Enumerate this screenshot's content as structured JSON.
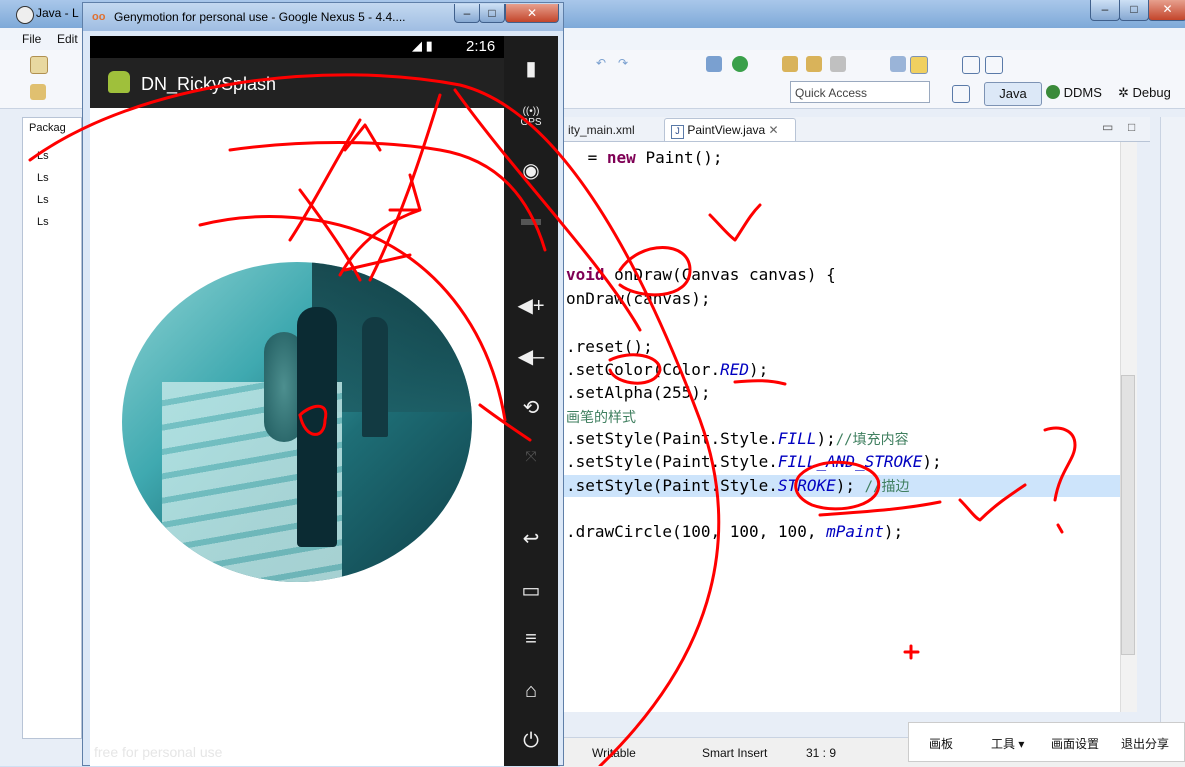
{
  "eclipse": {
    "title": "Java - L",
    "menu": [
      "File",
      "Edit"
    ],
    "quick_access": "Quick Access",
    "perspectives": [
      "Java",
      "DDMS",
      "Debug"
    ],
    "package_explorer_tab": "Packag",
    "package_rows": [
      "Ls",
      "Ls",
      "Ls",
      "Ls"
    ],
    "editor_tabs": [
      "ity_main.xml",
      "PaintView.java"
    ],
    "code_lines": [
      {
        "pre": " = ",
        "kw": "new",
        "post": " Paint();"
      },
      {
        "pre": "",
        "kw": "void",
        "post": " onDraw(Canvas canvas) {"
      },
      {
        "pre": "onDraw(canvas);",
        "kw": "",
        "post": ""
      },
      {
        "pre": ".reset();",
        "kw": "",
        "post": ""
      },
      {
        "pre": ".setColor(Color.",
        "field": "RED",
        "post": ");"
      },
      {
        "pre": ".setAlpha(255);",
        "kw": "",
        "post": ""
      },
      {
        "comment": "画笔的样式"
      },
      {
        "pre": ".setStyle(Paint.Style.",
        "field": "FILL",
        "post": ");",
        "comment": "//填充内容"
      },
      {
        "pre": ".setStyle(Paint.Style.",
        "field": "FILL_AND_STROKE",
        "post": ");"
      },
      {
        "pre": ".setStyle(Paint.Style.",
        "field": "STROKE",
        "post": ");",
        "comment": "//描边"
      },
      {
        "pre": ".drawCircle(100, 100, 100, ",
        "field2": "mPaint",
        "post": ");"
      }
    ],
    "status": {
      "writable": "Writable",
      "insert": "Smart Insert",
      "position": "31 : 9"
    },
    "overlay_tools": [
      "画板",
      "工具 ▾",
      "画面设置",
      "退出分享"
    ]
  },
  "genymotion": {
    "title": "Genymotion for personal use - Google Nexus 5 - 4.4....",
    "status_time": "2:16",
    "app_title": "DN_RickySplash",
    "watermark": "free for personal use",
    "sidebar": [
      "battery-icon",
      "gps-icon",
      "webcam-icon",
      "media-icon",
      "volume-up-icon",
      "volume-down-icon",
      "rotate-icon",
      "pixel-perfect-icon",
      "back-icon",
      "recent-apps-icon",
      "menu-icon",
      "home-icon",
      "power-icon"
    ],
    "gps_label": "GPS"
  },
  "colors": {
    "annotation": "#ff0000",
    "selection": "#cde4fb"
  }
}
